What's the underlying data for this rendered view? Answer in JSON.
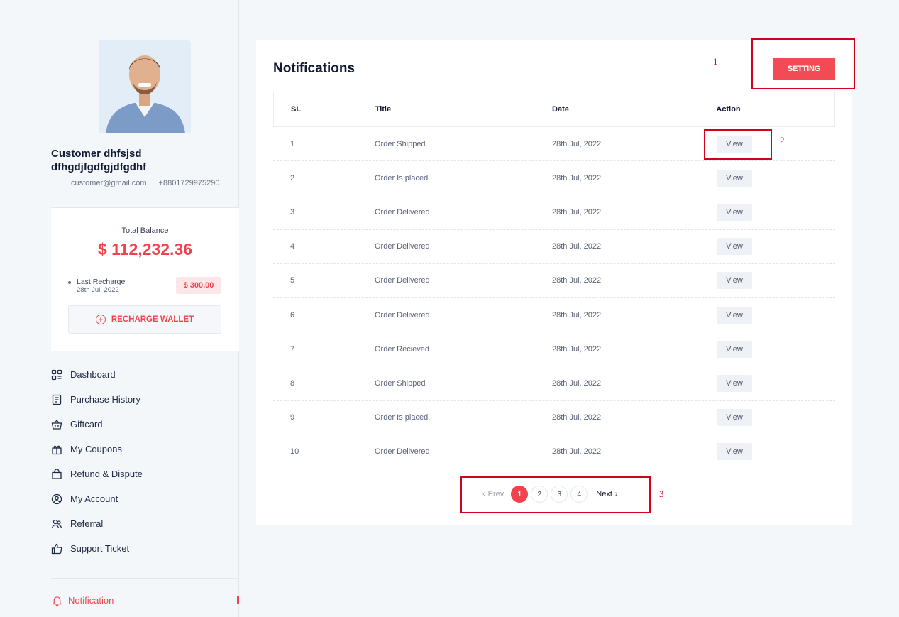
{
  "profile": {
    "name": "Customer dhfsjsd dfhgdjfgdfgjdfgdhf",
    "email": "customer@gmail.com",
    "phone": "+8801729975290"
  },
  "wallet": {
    "balance_label": "Total Balance",
    "balance": "$ 112,232.36",
    "last_recharge_label": "Last Recharge",
    "last_recharge_date": "28th Jul, 2022",
    "last_recharge_amount": "$ 300.00",
    "recharge_button": "RECHARGE WALLET"
  },
  "menu": [
    {
      "label": "Dashboard",
      "icon": "dashboard-icon"
    },
    {
      "label": "Purchase History",
      "icon": "receipt-icon"
    },
    {
      "label": "Giftcard",
      "icon": "basket-icon"
    },
    {
      "label": "My Coupons",
      "icon": "gift-icon"
    },
    {
      "label": "Refund & Dispute",
      "icon": "bag-icon"
    },
    {
      "label": "My Account",
      "icon": "user-circle-icon"
    },
    {
      "label": "Referral",
      "icon": "users-icon"
    },
    {
      "label": "Support Ticket",
      "icon": "thumbs-up-icon"
    }
  ],
  "active_menu": {
    "label": "Notification",
    "icon": "bell-icon"
  },
  "notifications": {
    "title": "Notifications",
    "setting_button": "SETTING",
    "columns": [
      "SL",
      "Title",
      "Date",
      "Action"
    ],
    "rows": [
      {
        "sl": "1",
        "title": "Order Shipped",
        "date": "28th Jul, 2022",
        "action": "View"
      },
      {
        "sl": "2",
        "title": "Order Is placed.",
        "date": "28th Jul, 2022",
        "action": "View"
      },
      {
        "sl": "3",
        "title": "Order Delivered",
        "date": "28th Jul, 2022",
        "action": "View"
      },
      {
        "sl": "4",
        "title": "Order Delivered",
        "date": "28th Jul, 2022",
        "action": "View"
      },
      {
        "sl": "5",
        "title": "Order Delivered",
        "date": "28th Jul, 2022",
        "action": "View"
      },
      {
        "sl": "6",
        "title": "Order Delivered",
        "date": "28th Jul, 2022",
        "action": "View"
      },
      {
        "sl": "7",
        "title": "Order Recieved",
        "date": "28th Jul, 2022",
        "action": "View"
      },
      {
        "sl": "8",
        "title": "Order Shipped",
        "date": "28th Jul, 2022",
        "action": "View"
      },
      {
        "sl": "9",
        "title": "Order Is placed.",
        "date": "28th Jul, 2022",
        "action": "View"
      },
      {
        "sl": "10",
        "title": "Order Delivered",
        "date": "28th Jul, 2022",
        "action": "View"
      }
    ]
  },
  "pagination": {
    "prev": "Prev",
    "pages": [
      "1",
      "2",
      "3",
      "4"
    ],
    "current": "1",
    "next": "Next"
  },
  "annotations": [
    "1",
    "2",
    "3"
  ],
  "colors": {
    "accent": "#f0434d",
    "annotation": "#d0021b",
    "background": "#f4f7fa"
  }
}
